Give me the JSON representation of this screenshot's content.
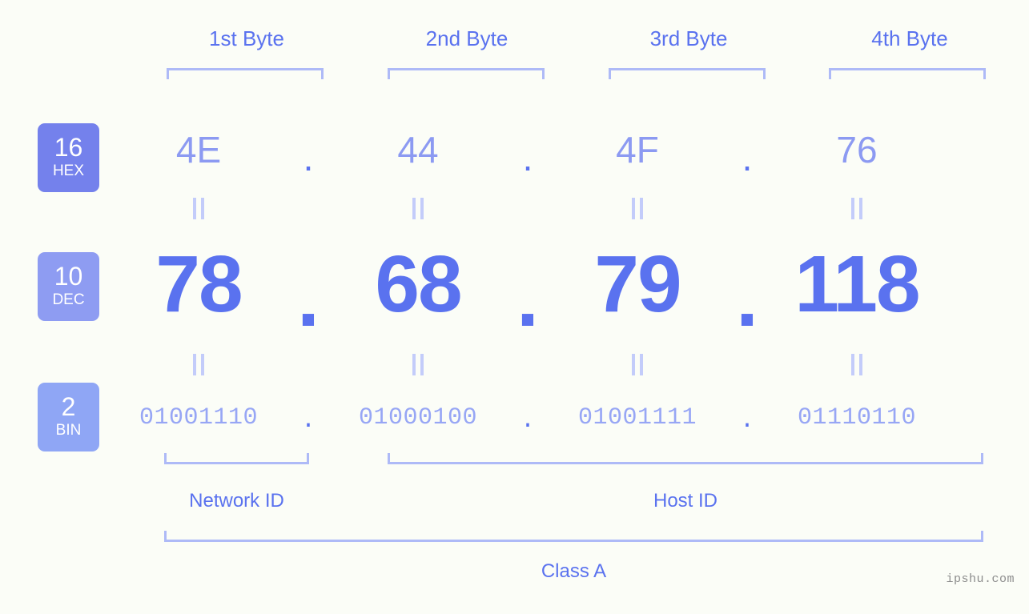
{
  "background_color": "#fbfdf7",
  "accent_color": "#5a72ef",
  "bracket_color": "#aebaf7",
  "byte_headers": [
    {
      "label": "1st Byte"
    },
    {
      "label": "2nd Byte"
    },
    {
      "label": "3rd Byte"
    },
    {
      "label": "4th Byte"
    }
  ],
  "radix_rows": [
    {
      "badge_number": "16",
      "badge_name": "HEX",
      "badge_color": "#7481ec",
      "values": [
        "4E",
        "44",
        "4F",
        "76"
      ],
      "separator": "."
    },
    {
      "badge_number": "10",
      "badge_name": "DEC",
      "badge_color": "#8e9cf2",
      "values": [
        "78",
        "68",
        "79",
        "118"
      ],
      "separator": "."
    },
    {
      "badge_number": "2",
      "badge_name": "BIN",
      "badge_color": "#8fa6f5",
      "values": [
        "01001110",
        "01000100",
        "01001111",
        "01110110"
      ],
      "separator": "."
    }
  ],
  "id_sections": [
    {
      "label": "Network ID"
    },
    {
      "label": "Host ID"
    }
  ],
  "class_label": "Class A",
  "watermark": "ipshu.com"
}
